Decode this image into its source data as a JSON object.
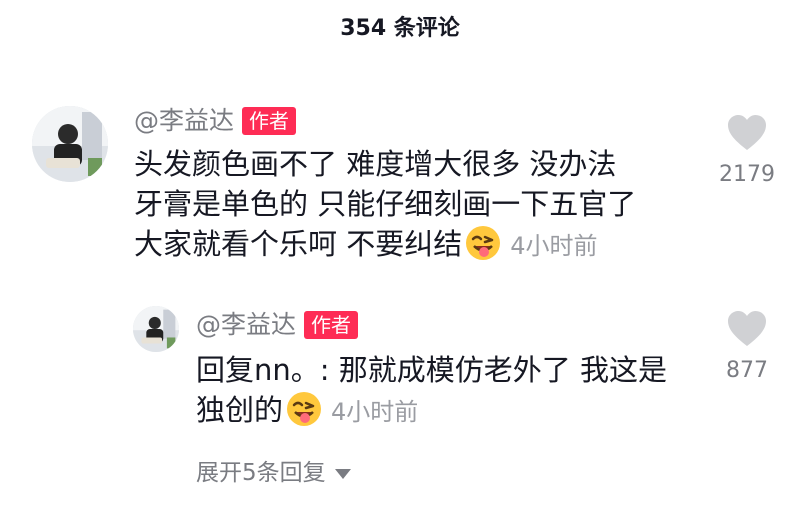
{
  "header": {
    "title": "354 条评论"
  },
  "comment": {
    "username": "@李益达",
    "badge": "作者",
    "lines": [
      "头发颜色画不了 难度增大很多 没办法",
      "牙膏是单色的 只能仔细刻画一下五官了",
      "大家就看个乐呵 不要纠结"
    ],
    "emoji": "wink-tongue-emoji",
    "time": "4小时前",
    "likes": "2179"
  },
  "reply": {
    "username": "@李益达",
    "badge": "作者",
    "lines": [
      "回复nn。: 那就成模仿老外了 我这是",
      "独创的"
    ],
    "emoji": "wink-tongue-emoji",
    "time": "4小时前",
    "likes": "877"
  },
  "expand": {
    "label": "展开5条回复"
  },
  "colors": {
    "badge": "#fe2c55",
    "meta_text": "#7a7c82",
    "heart": "#d0d1d4",
    "emoji_face": "#ffc83d"
  }
}
